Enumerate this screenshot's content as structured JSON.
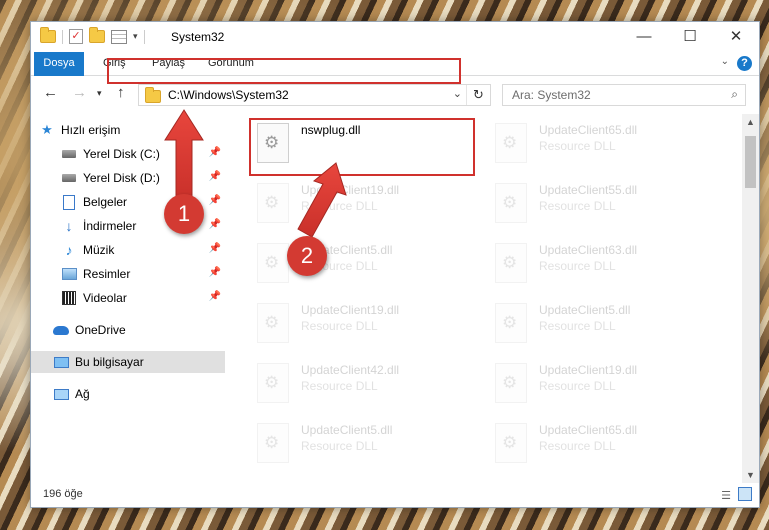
{
  "window": {
    "title": "System32",
    "controls": {
      "minimize": "—",
      "maximize": "☐",
      "close": "✕"
    }
  },
  "ribbon": {
    "tabs": [
      "Dosya",
      "Giriş",
      "Paylaş",
      "Görünüm"
    ],
    "help": "?"
  },
  "nav": {
    "address_path": "C:\\Windows\\System32",
    "search_placeholder": "Ara: System32"
  },
  "sidebar": {
    "items": [
      {
        "label": "Hızlı erişim",
        "icon": "star-icon"
      },
      {
        "label": "Yerel Disk (C:)",
        "icon": "drive-icon"
      },
      {
        "label": "Yerel Disk (D:)",
        "icon": "drive-icon"
      },
      {
        "label": "Belgeler",
        "icon": "documents-icon"
      },
      {
        "label": "İndirmeler",
        "icon": "downloads-icon"
      },
      {
        "label": "Müzik",
        "icon": "music-icon"
      },
      {
        "label": "Resimler",
        "icon": "pictures-icon"
      },
      {
        "label": "Videolar",
        "icon": "videos-icon"
      },
      {
        "label": "OneDrive",
        "icon": "cloud-icon"
      },
      {
        "label": "Bu bilgisayar",
        "icon": "computer-icon"
      },
      {
        "label": "Ağ",
        "icon": "network-icon"
      }
    ]
  },
  "files": [
    {
      "name": "nswplug.dll",
      "type": ""
    },
    {
      "name": "UpdateClient65.dll",
      "type": "Resource DLL"
    },
    {
      "name": "UpdateClient19.dll",
      "type": "Resource DLL"
    },
    {
      "name": "UpdateClient55.dll",
      "type": "Resource DLL"
    },
    {
      "name": "UpdateClient5.dll",
      "type": "Resource DLL"
    },
    {
      "name": "UpdateClient63.dll",
      "type": "Resource DLL"
    },
    {
      "name": "UpdateClient19.dll",
      "type": "Resource DLL"
    },
    {
      "name": "UpdateClient5.dll",
      "type": "Resource DLL"
    },
    {
      "name": "UpdateClient42.dll",
      "type": "Resource DLL"
    },
    {
      "name": "UpdateClient19.dll",
      "type": "Resource DLL"
    },
    {
      "name": "UpdateClient5.dll",
      "type": "Resource DLL"
    },
    {
      "name": "UpdateClient65.dll",
      "type": "Resource DLL"
    }
  ],
  "status": {
    "item_count": "196 öğe"
  },
  "annotations": {
    "step1": "1",
    "step2": "2",
    "color": "#d33a32"
  }
}
